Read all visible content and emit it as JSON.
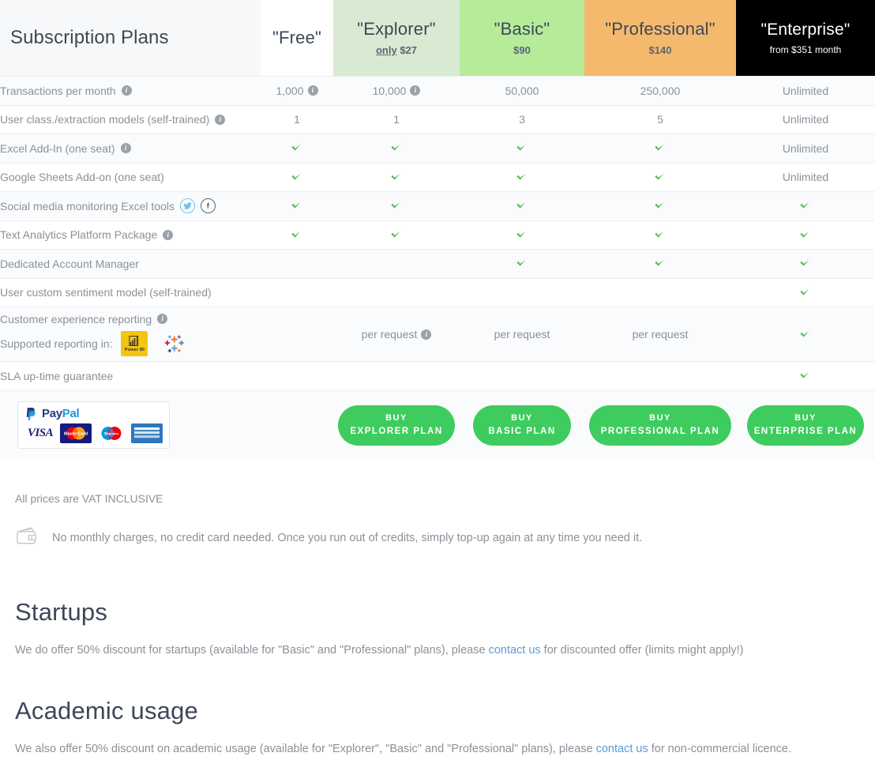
{
  "table": {
    "title": "Subscription Plans",
    "plans": [
      {
        "id": "free",
        "name": "\"Free\"",
        "price": "",
        "price_prefix": ""
      },
      {
        "id": "explorer",
        "name": "\"Explorer\"",
        "price": "$27",
        "price_prefix": "only"
      },
      {
        "id": "basic",
        "name": "\"Basic\"",
        "price": "$90",
        "price_prefix": ""
      },
      {
        "id": "professional",
        "name": "\"Professional\"",
        "price": "$140",
        "price_prefix": ""
      },
      {
        "id": "enterprise",
        "name": "\"Enterprise\"",
        "price": "from $351 month",
        "price_prefix": ""
      }
    ],
    "rows": [
      {
        "feature": "Transactions per month",
        "info": true,
        "values": [
          "1,000",
          "10,000",
          "50,000",
          "250,000",
          "Unlimited"
        ],
        "value_info": [
          true,
          true,
          false,
          false,
          false
        ]
      },
      {
        "feature": "User class./extraction models (self-trained)",
        "info": true,
        "values": [
          "1",
          "1",
          "3",
          "5",
          "Unlimited"
        ],
        "value_info": [
          false,
          false,
          false,
          false,
          false
        ]
      },
      {
        "feature": "Excel Add-In (one seat)",
        "info": true,
        "values": [
          "check",
          "check",
          "check",
          "check",
          "Unlimited"
        ],
        "value_info": [
          false,
          false,
          false,
          false,
          false
        ]
      },
      {
        "feature": "Google Sheets Add-on (one seat)",
        "info": false,
        "values": [
          "check",
          "check",
          "check",
          "check",
          "Unlimited"
        ],
        "value_info": [
          false,
          false,
          false,
          false,
          false
        ]
      },
      {
        "feature": "Social media monitoring Excel tools",
        "info": false,
        "social": true,
        "values": [
          "check",
          "check",
          "check",
          "check",
          "check"
        ],
        "value_info": [
          false,
          false,
          false,
          false,
          false
        ]
      },
      {
        "feature": "Text Analytics Platform Package",
        "info": true,
        "values": [
          "check",
          "check",
          "check",
          "check",
          "check"
        ],
        "value_info": [
          false,
          false,
          false,
          false,
          false
        ]
      },
      {
        "feature": "Dedicated Account Manager",
        "info": false,
        "values": [
          "",
          "",
          "check",
          "check",
          "check"
        ],
        "value_info": [
          false,
          false,
          false,
          false,
          false
        ]
      },
      {
        "feature": "User custom sentiment model (self-trained)",
        "info": false,
        "values": [
          "",
          "",
          "",
          "",
          "check"
        ],
        "value_info": [
          false,
          false,
          false,
          false,
          false
        ]
      },
      {
        "feature": "Customer experience reporting",
        "info": true,
        "tall": true,
        "feature2": "Supported reporting in:",
        "reporting_icons": true,
        "values": [
          "",
          "per request",
          "per request",
          "per request",
          "check"
        ],
        "value_info": [
          false,
          true,
          false,
          false,
          false
        ]
      },
      {
        "feature": "SLA up-time guarantee",
        "info": false,
        "values": [
          "",
          "",
          "",
          "",
          "check"
        ],
        "value_info": [
          false,
          false,
          false,
          false,
          false
        ]
      }
    ],
    "buy_buttons": [
      {
        "plan": "free",
        "line1": "",
        "line2": ""
      },
      {
        "plan": "explorer",
        "line1": "BUY",
        "line2": "EXPLORER PLAN"
      },
      {
        "plan": "basic",
        "line1": "BUY",
        "line2": "BASIC PLAN"
      },
      {
        "plan": "professional",
        "line1": "BUY",
        "line2": "PROFESSIONAL PLAN"
      },
      {
        "plan": "enterprise",
        "line1": "BUY",
        "line2": "ENTERPRISE PLAN"
      }
    ],
    "payment": {
      "paypal_pay": "Pay",
      "paypal_pal": "Pal",
      "cards": [
        "VISA",
        "MasterCard",
        "Maestro",
        "American Express"
      ]
    },
    "reporting_tools": [
      "Power BI",
      "Tableau"
    ],
    "social_tools": [
      "Twitter",
      "Facebook"
    ]
  },
  "notes": {
    "vat": "All prices are VAT INCLUSIVE",
    "credits": "No monthly charges, no credit card needed. Once you run out of credits, simply top-up again at any time you need it."
  },
  "startups": {
    "heading": "Startups",
    "text_before": "We do offer 50% discount for startups (available for \"Basic\" and \"Professional\" plans), please ",
    "link": "contact us",
    "text_after": " for discounted offer (limits might apply!)"
  },
  "academic": {
    "heading": "Academic usage",
    "text_before": "We also offer 50% discount on academic usage (available for \"Explorer\", \"Basic\" and \"Professional\" plans), please ",
    "link": "contact us",
    "text_after": " for non-commercial licence."
  },
  "colors": {
    "explorer": "#d9ead3",
    "basic": "#b6eb9a",
    "professional": "#f5b96e",
    "enterprise": "#000000",
    "check": "#5cb85c",
    "buy": "#3ecc5f",
    "link": "#5b9bd5",
    "powerbi": "#f2c511"
  }
}
